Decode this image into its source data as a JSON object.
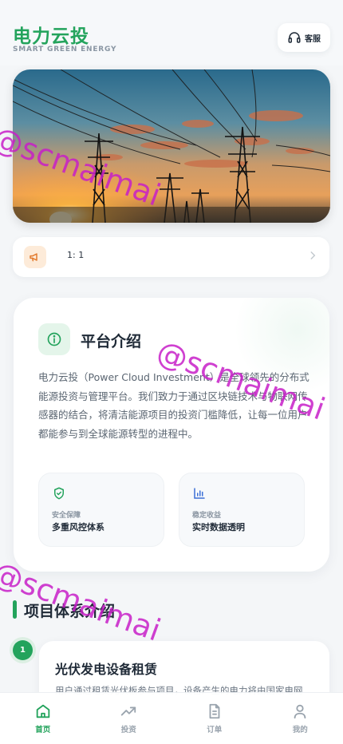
{
  "header": {
    "title": "电力云投",
    "subtitle": "SMART GREEN ENERGY",
    "service_label": "客服"
  },
  "banner": {
    "image": "power-transmission-towers-at-sunset"
  },
  "notice": {
    "text": "1: 1"
  },
  "intro": {
    "title": "平台介绍",
    "body": "电力云投（Power Cloud Investment）是全球领先的分布式能源投资与管理平台。我们致力于通过区块链技术与物联网传感器的结合，将清洁能源项目的投资门槛降低，让每一位用户都能参与到全球能源转型的进程中。",
    "features": [
      {
        "sub": "安全保障",
        "title": "多重风控体系",
        "icon": "shield-check-icon"
      },
      {
        "sub": "稳定收益",
        "title": "实时数据透明",
        "icon": "bar-chart-icon"
      }
    ]
  },
  "projects": {
    "section_title": "项目体系介绍",
    "items": [
      {
        "index": "1",
        "title": "光伏发电设备租赁",
        "desc": "用户通过租赁光伏板参与项目，设备产生的电力将由国家电网"
      }
    ]
  },
  "tabbar": {
    "items": [
      {
        "label": "首页",
        "icon": "home-icon",
        "active": true
      },
      {
        "label": "投资",
        "icon": "trend-icon",
        "active": false
      },
      {
        "label": "订单",
        "icon": "document-icon",
        "active": false
      },
      {
        "label": "我的",
        "icon": "user-icon",
        "active": false
      }
    ]
  },
  "watermark": "@scmaimai",
  "colors": {
    "brand": "#23a35c",
    "watermark": "#c71fc8"
  }
}
